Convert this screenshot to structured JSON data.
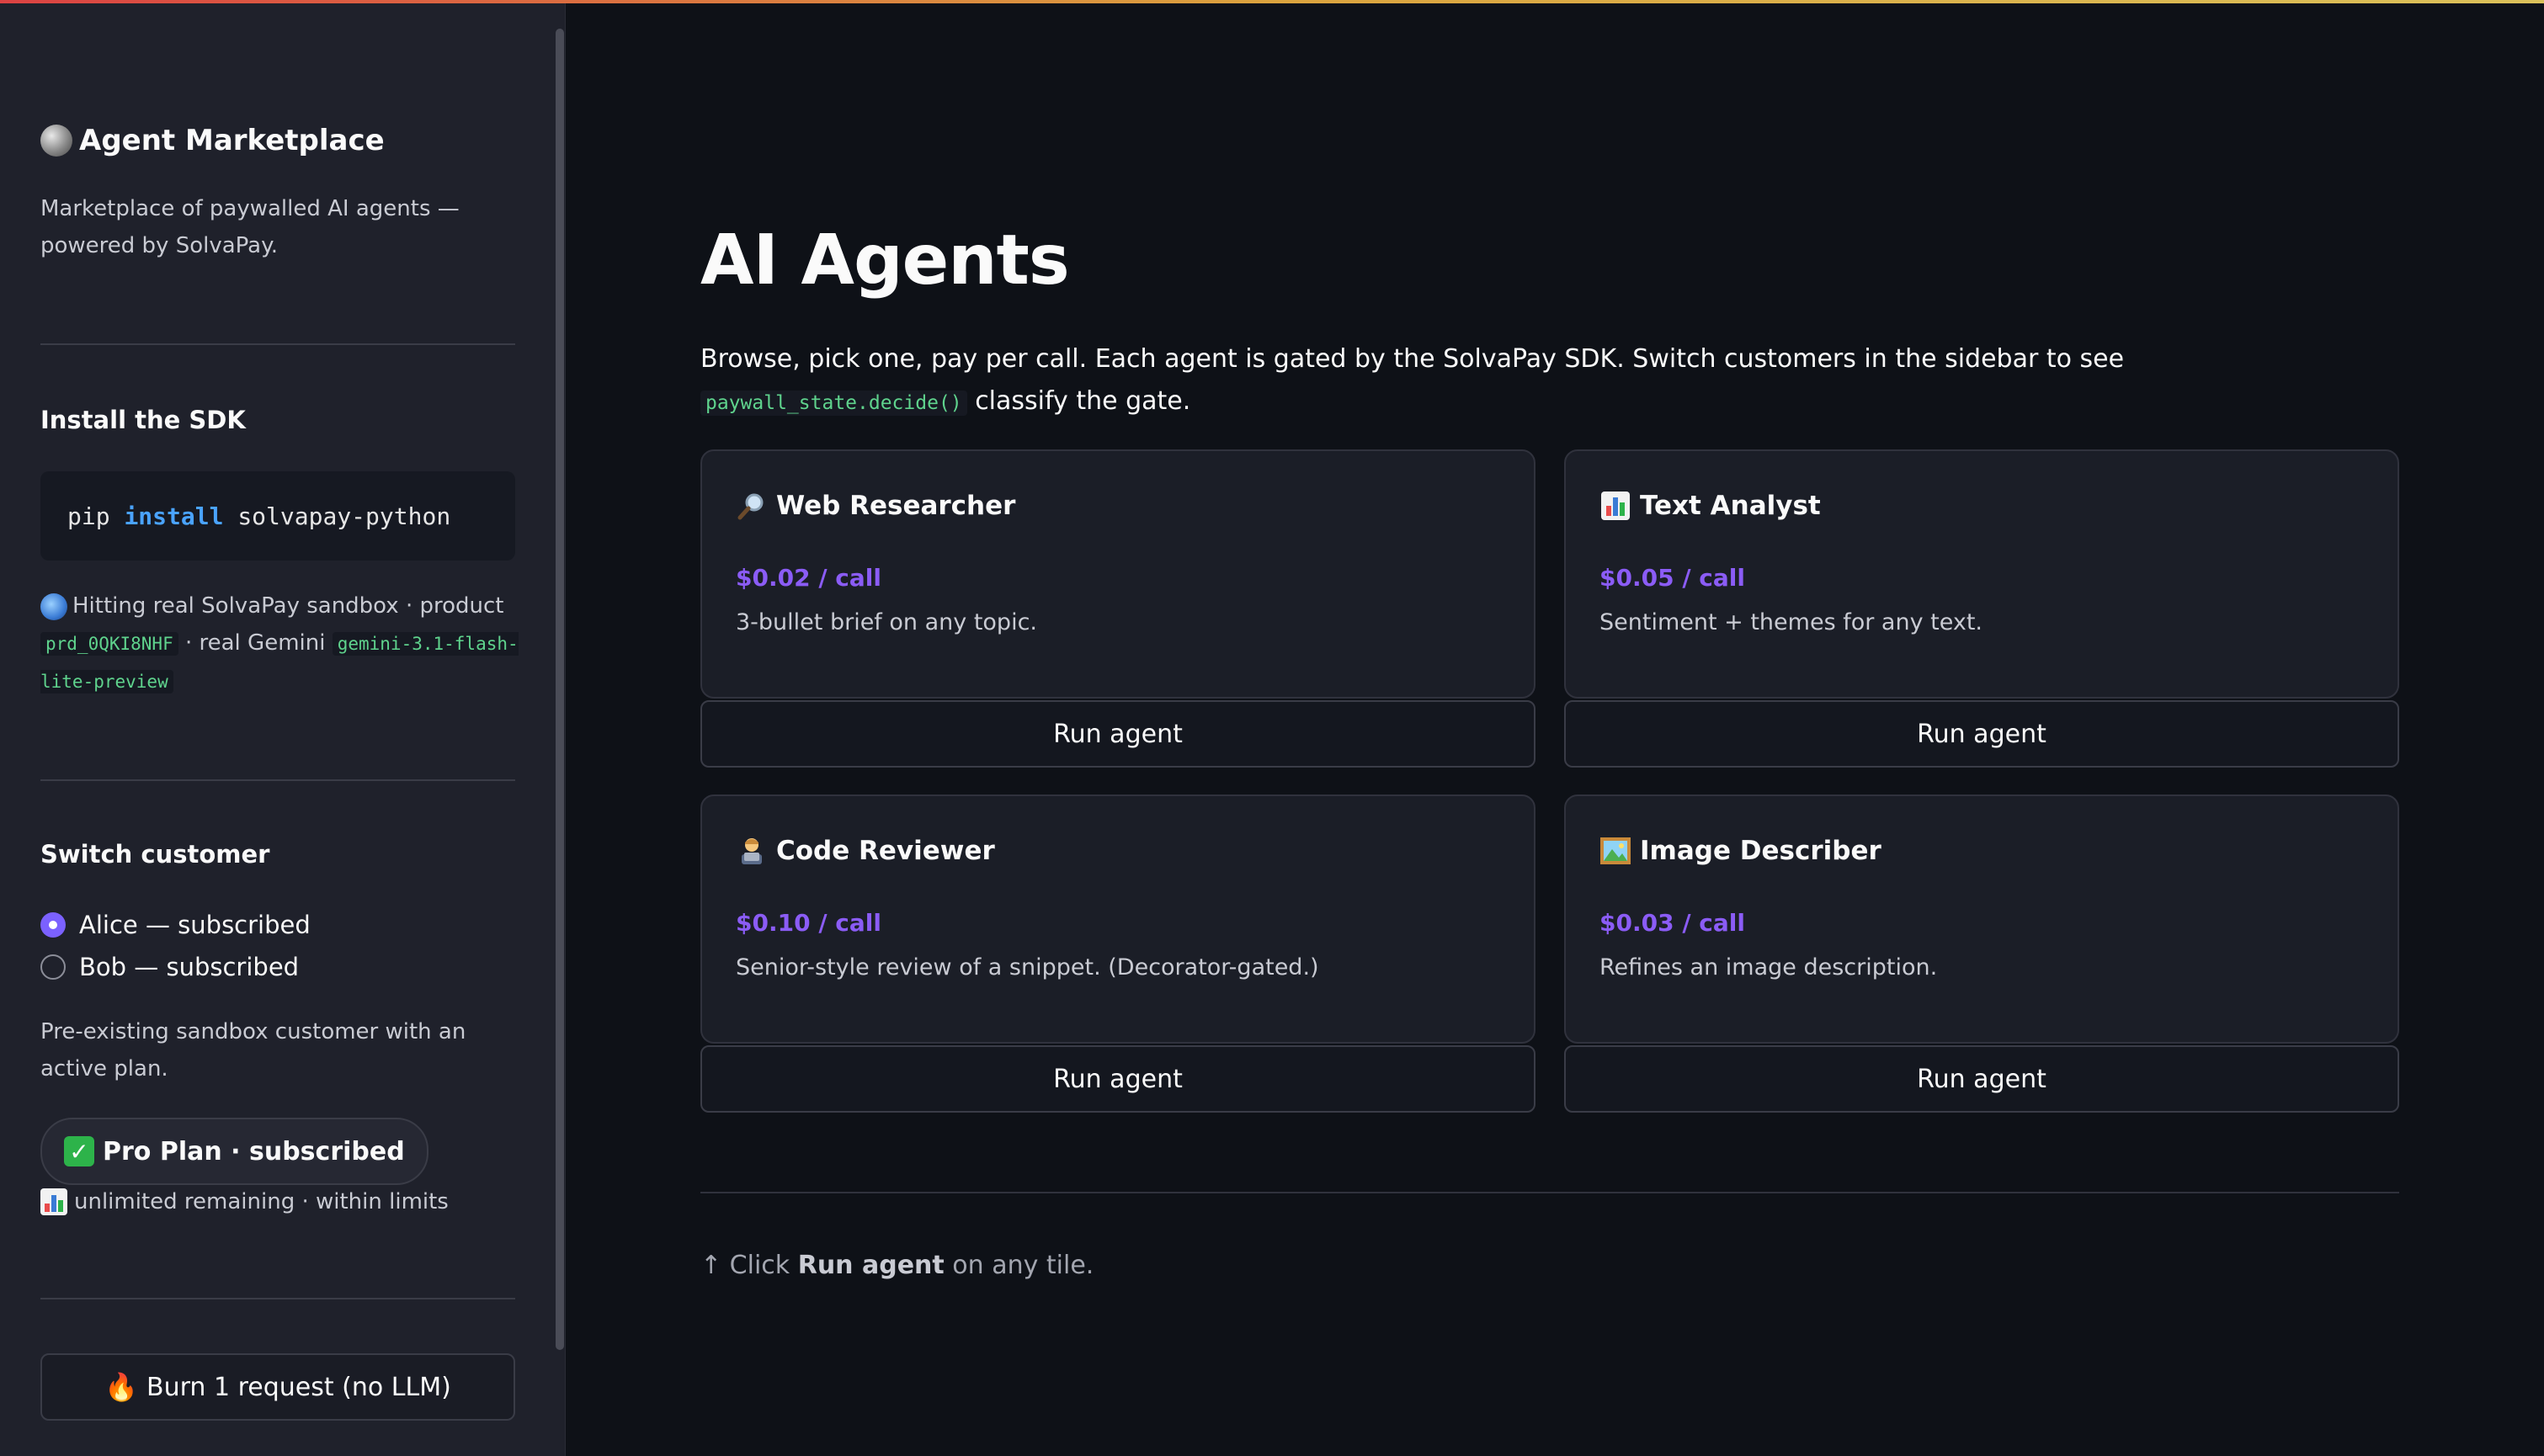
{
  "sidebar": {
    "title": "Agent Marketplace",
    "description": "Marketplace of paywalled AI agents — powered by SolvaPay.",
    "install_heading": "Install the SDK",
    "install_cmd": {
      "pre": "pip",
      "kw": "install",
      "post": "solvapay-python"
    },
    "info": {
      "text1": "Hitting real SolvaPay sandbox · product",
      "product_code": "prd_0QKI8NHF",
      "text2": "· real Gemini",
      "model_code": "gemini-3.1-flash-lite-preview"
    },
    "switch_heading": "Switch customer",
    "customers": [
      {
        "label": "Alice — subscribed",
        "selected": true
      },
      {
        "label": "Bob — subscribed",
        "selected": false
      }
    ],
    "customer_note": "Pre-existing sandbox customer with an active plan.",
    "plan_badge": "Pro Plan · subscribed",
    "remaining": "unlimited remaining · within limits",
    "burn_button": "Burn 1 request (no LLM)"
  },
  "main": {
    "title": "AI Agents",
    "desc_pre": "Browse, pick one, pay per call. Each agent is gated by the SolvaPay SDK. Switch customers in the sidebar to see",
    "desc_code": "paywall_state.decide()",
    "desc_post": "classify the gate.",
    "agents": [
      {
        "icon": "magnifier-icon",
        "name": "Web Researcher",
        "price": "$0.02 / call",
        "desc": "3-bullet brief on any topic.",
        "button": "Run agent"
      },
      {
        "icon": "bar-chart-icon",
        "name": "Text Analyst",
        "price": "$0.05 / call",
        "desc": "Sentiment + themes for any text.",
        "button": "Run agent"
      },
      {
        "icon": "technologist-icon",
        "name": "Code Reviewer",
        "price": "$0.10 / call",
        "desc": "Senior-style review of a snippet. (Decorator-gated.)",
        "button": "Run agent"
      },
      {
        "icon": "framed-picture-icon",
        "name": "Image Describer",
        "price": "$0.03 / call",
        "desc": "Refines an image description.",
        "button": "Run agent"
      }
    ],
    "hint_pre": "↑ Click",
    "hint_bold": "Run agent",
    "hint_post": "on any tile."
  },
  "colors": {
    "background": "#0e1117",
    "sidebar": "#1f212b",
    "accent_price": "#8b5cf6",
    "radio_selected": "#7b61ff",
    "code_green": "#5fd38d",
    "keyword_blue": "#4aa3ff"
  }
}
